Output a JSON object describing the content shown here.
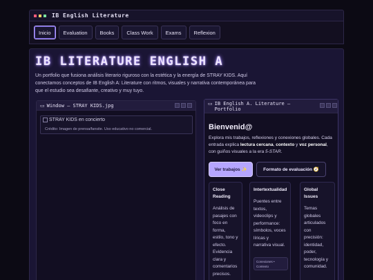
{
  "window": {
    "title": "IB English Literature",
    "dots": [
      "#ff5c7a",
      "#ffd166",
      "#7be3a1"
    ]
  },
  "nav": {
    "items": [
      "Inicio",
      "Evaluation",
      "Books",
      "Class Work",
      "Exams",
      "Reflexion"
    ],
    "active": "Inicio"
  },
  "hero": {
    "title": "IB LITERATURE ENGLISH A",
    "description": "Un portfolio que fusiona análisis literario riguroso con la estética y la energía de STRAY KIDS. Aquí conectamos conceptos de IB English A: Literature con ritmos, visuales y narrativa contemporánea para que el estudio sea desafiante, creativo y muy tuyo."
  },
  "left_window": {
    "title": "Window — STRAY KIDS.jpg",
    "image_alt": "STRAY KIDS en concierto",
    "credit": "Crédito: Imagen de prensa/fansite. Uso educativo no comercial."
  },
  "right_window": {
    "title": "IB English A. Literature — Portfolio",
    "heading": "Bienvenid@",
    "desc_1": "Explora mis trabajos, reflexiones y conexiones globales. Cada entrada explica ",
    "desc_b1": "lectura cercana",
    "desc_2": ", ",
    "desc_b2": "contexto",
    "desc_3": " y ",
    "desc_b3": "voz personal",
    "desc_4": ", con guiños visuales a la era ",
    "desc_i": "5-STAR",
    "desc_5": ".",
    "cta_primary": "Ver trabajos ✨",
    "cta_secondary": "Formato de evaluación 🧭",
    "cards": [
      {
        "title": "Close Reading",
        "body": "Análisis de pasajes con foco en forma, estilo, tono y efecto. Evidencia clara y comentarios precisos."
      },
      {
        "title": "Intertextualidad",
        "body": "Puentes entre textos, videoclips y performance: símbolos, voces líricas y narrativa visual.",
        "tag": "Conexiones • Contexto"
      },
      {
        "title": "Global Issues",
        "body": "Temas globales articulados con precisión: identidad, poder, tecnología y comunidad."
      }
    ]
  },
  "colors": {
    "accent": "#b6a6ff",
    "background": "#0c0a14",
    "panel": "#1a1534"
  }
}
